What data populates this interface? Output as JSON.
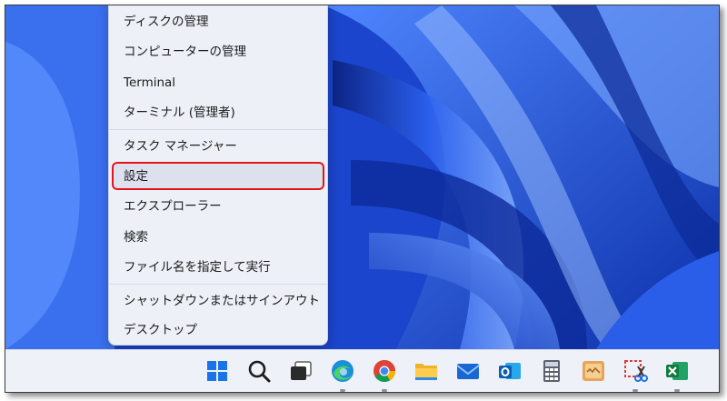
{
  "menu": {
    "items": [
      {
        "label": "ディスクの管理"
      },
      {
        "label": "コンピューターの管理"
      },
      {
        "label": "Terminal"
      },
      {
        "label": "ターミナル (管理者)"
      },
      {
        "label": "タスク マネージャー"
      },
      {
        "label": "設定",
        "highlighted": true
      },
      {
        "label": "エクスプローラー"
      },
      {
        "label": "検索"
      },
      {
        "label": "ファイル名を指定して実行"
      },
      {
        "label": "シャットダウンまたはサインアウト",
        "submenu_icon": "chevron-right-icon"
      },
      {
        "label": "デスクトップ"
      }
    ],
    "highlight_color": "#e3141b"
  },
  "taskbar": {
    "icons": [
      {
        "name": "start-windows-icon",
        "running": false
      },
      {
        "name": "search-icon",
        "running": false
      },
      {
        "name": "task-view-icon",
        "running": false
      },
      {
        "name": "edge-icon",
        "running": true
      },
      {
        "name": "chrome-icon",
        "running": true
      },
      {
        "name": "file-explorer-icon",
        "running": false
      },
      {
        "name": "mail-icon",
        "running": false
      },
      {
        "name": "outlook-icon",
        "running": false
      },
      {
        "name": "calculator-icon",
        "running": false
      },
      {
        "name": "app-icon",
        "running": false
      },
      {
        "name": "snipping-tool-icon",
        "running": true
      },
      {
        "name": "excel-icon",
        "running": true
      }
    ]
  },
  "colors": {
    "wallpaper_blue": "#1f4fd8",
    "taskbar": "#eef1f7",
    "menu": "#eef0f8"
  }
}
